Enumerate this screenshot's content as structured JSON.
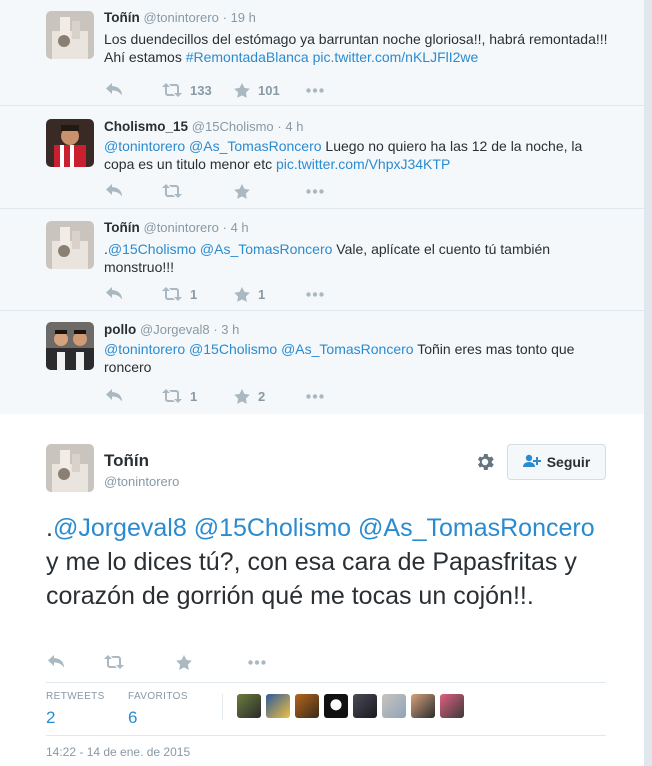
{
  "replies": [
    {
      "name": "Toñín",
      "handle": "@tonintorero",
      "time": "· 19 h",
      "text_parts": [
        {
          "t": "Los duendecillos del estómago ya barruntan noche gloriosa!!,  habrá remontada!!! Ahí estamos ",
          "link": false
        },
        {
          "t": "#RemontadaBlanca",
          "link": true
        },
        {
          "t": " ",
          "link": false
        },
        {
          "t": "pic.twitter.com/nKLJFlI2we",
          "link": true
        }
      ],
      "retweets": "133",
      "favorites": "101"
    },
    {
      "name": "Cholismo_15",
      "handle": "@15Cholismo",
      "time": "· 4 h",
      "text_parts": [
        {
          "t": "@tonintorero",
          "link": true
        },
        {
          "t": " ",
          "link": false
        },
        {
          "t": "@As_TomasRoncero",
          "link": true
        },
        {
          "t": " Luego no quiero ha las 12 de la noche, la copa es un titulo menor etc ",
          "link": false
        },
        {
          "t": "pic.twitter.com/VhpxJ34KTP",
          "link": true
        }
      ],
      "retweets": "",
      "favorites": ""
    },
    {
      "name": "Toñín",
      "handle": "@tonintorero",
      "time": "· 4 h",
      "text_parts": [
        {
          "t": ".",
          "link": false
        },
        {
          "t": "@15Cholismo",
          "link": true
        },
        {
          "t": " ",
          "link": false
        },
        {
          "t": "@As_TomasRoncero",
          "link": true
        },
        {
          "t": " Vale, aplícate el cuento tú también monstruo!!!",
          "link": false
        }
      ],
      "retweets": "1",
      "favorites": "1"
    },
    {
      "name": "pollo",
      "handle": "@Jorgeval8",
      "time": "· 3 h",
      "text_parts": [
        {
          "t": "@tonintorero",
          "link": true
        },
        {
          "t": " ",
          "link": false
        },
        {
          "t": "@15Cholismo",
          "link": true
        },
        {
          "t": " ",
          "link": false
        },
        {
          "t": "@As_TomasRoncero",
          "link": true
        },
        {
          "t": " Toñin eres mas tonto que roncero",
          "link": false
        }
      ],
      "retweets": "1",
      "favorites": "2"
    }
  ],
  "main": {
    "name": "Toñín",
    "handle": "@tonintorero",
    "follow_label": "Seguir",
    "text_parts": [
      {
        "t": ".",
        "link": false
      },
      {
        "t": "@Jorgeval8",
        "link": true
      },
      {
        "t": " ",
        "link": false
      },
      {
        "t": "@15Cholismo",
        "link": true
      },
      {
        "t": " ",
        "link": false
      },
      {
        "t": "@As_TomasRoncero",
        "link": true
      },
      {
        "t": " y me lo dices tú?, con esa cara de Papasfritas y corazón de gorrión qué me tocas un cojón!!.",
        "link": false
      }
    ],
    "retweets_label": "RETWEETS",
    "retweets_value": "2",
    "favorites_label": "FAVORITOS",
    "favorites_value": "6",
    "timestamp": "14:22 - 14 de ene. de 2015"
  },
  "colors": {
    "link": "#2a8bd0",
    "muted": "#8899a6",
    "action_icon": "#aab8c2",
    "conversation_bg": "#f5f8fa"
  },
  "icons": {
    "reply": "reply-icon",
    "retweet": "retweet-icon",
    "favorite": "star-icon",
    "more": "more-icon",
    "gear": "gear-icon",
    "follow": "add-person-icon"
  }
}
